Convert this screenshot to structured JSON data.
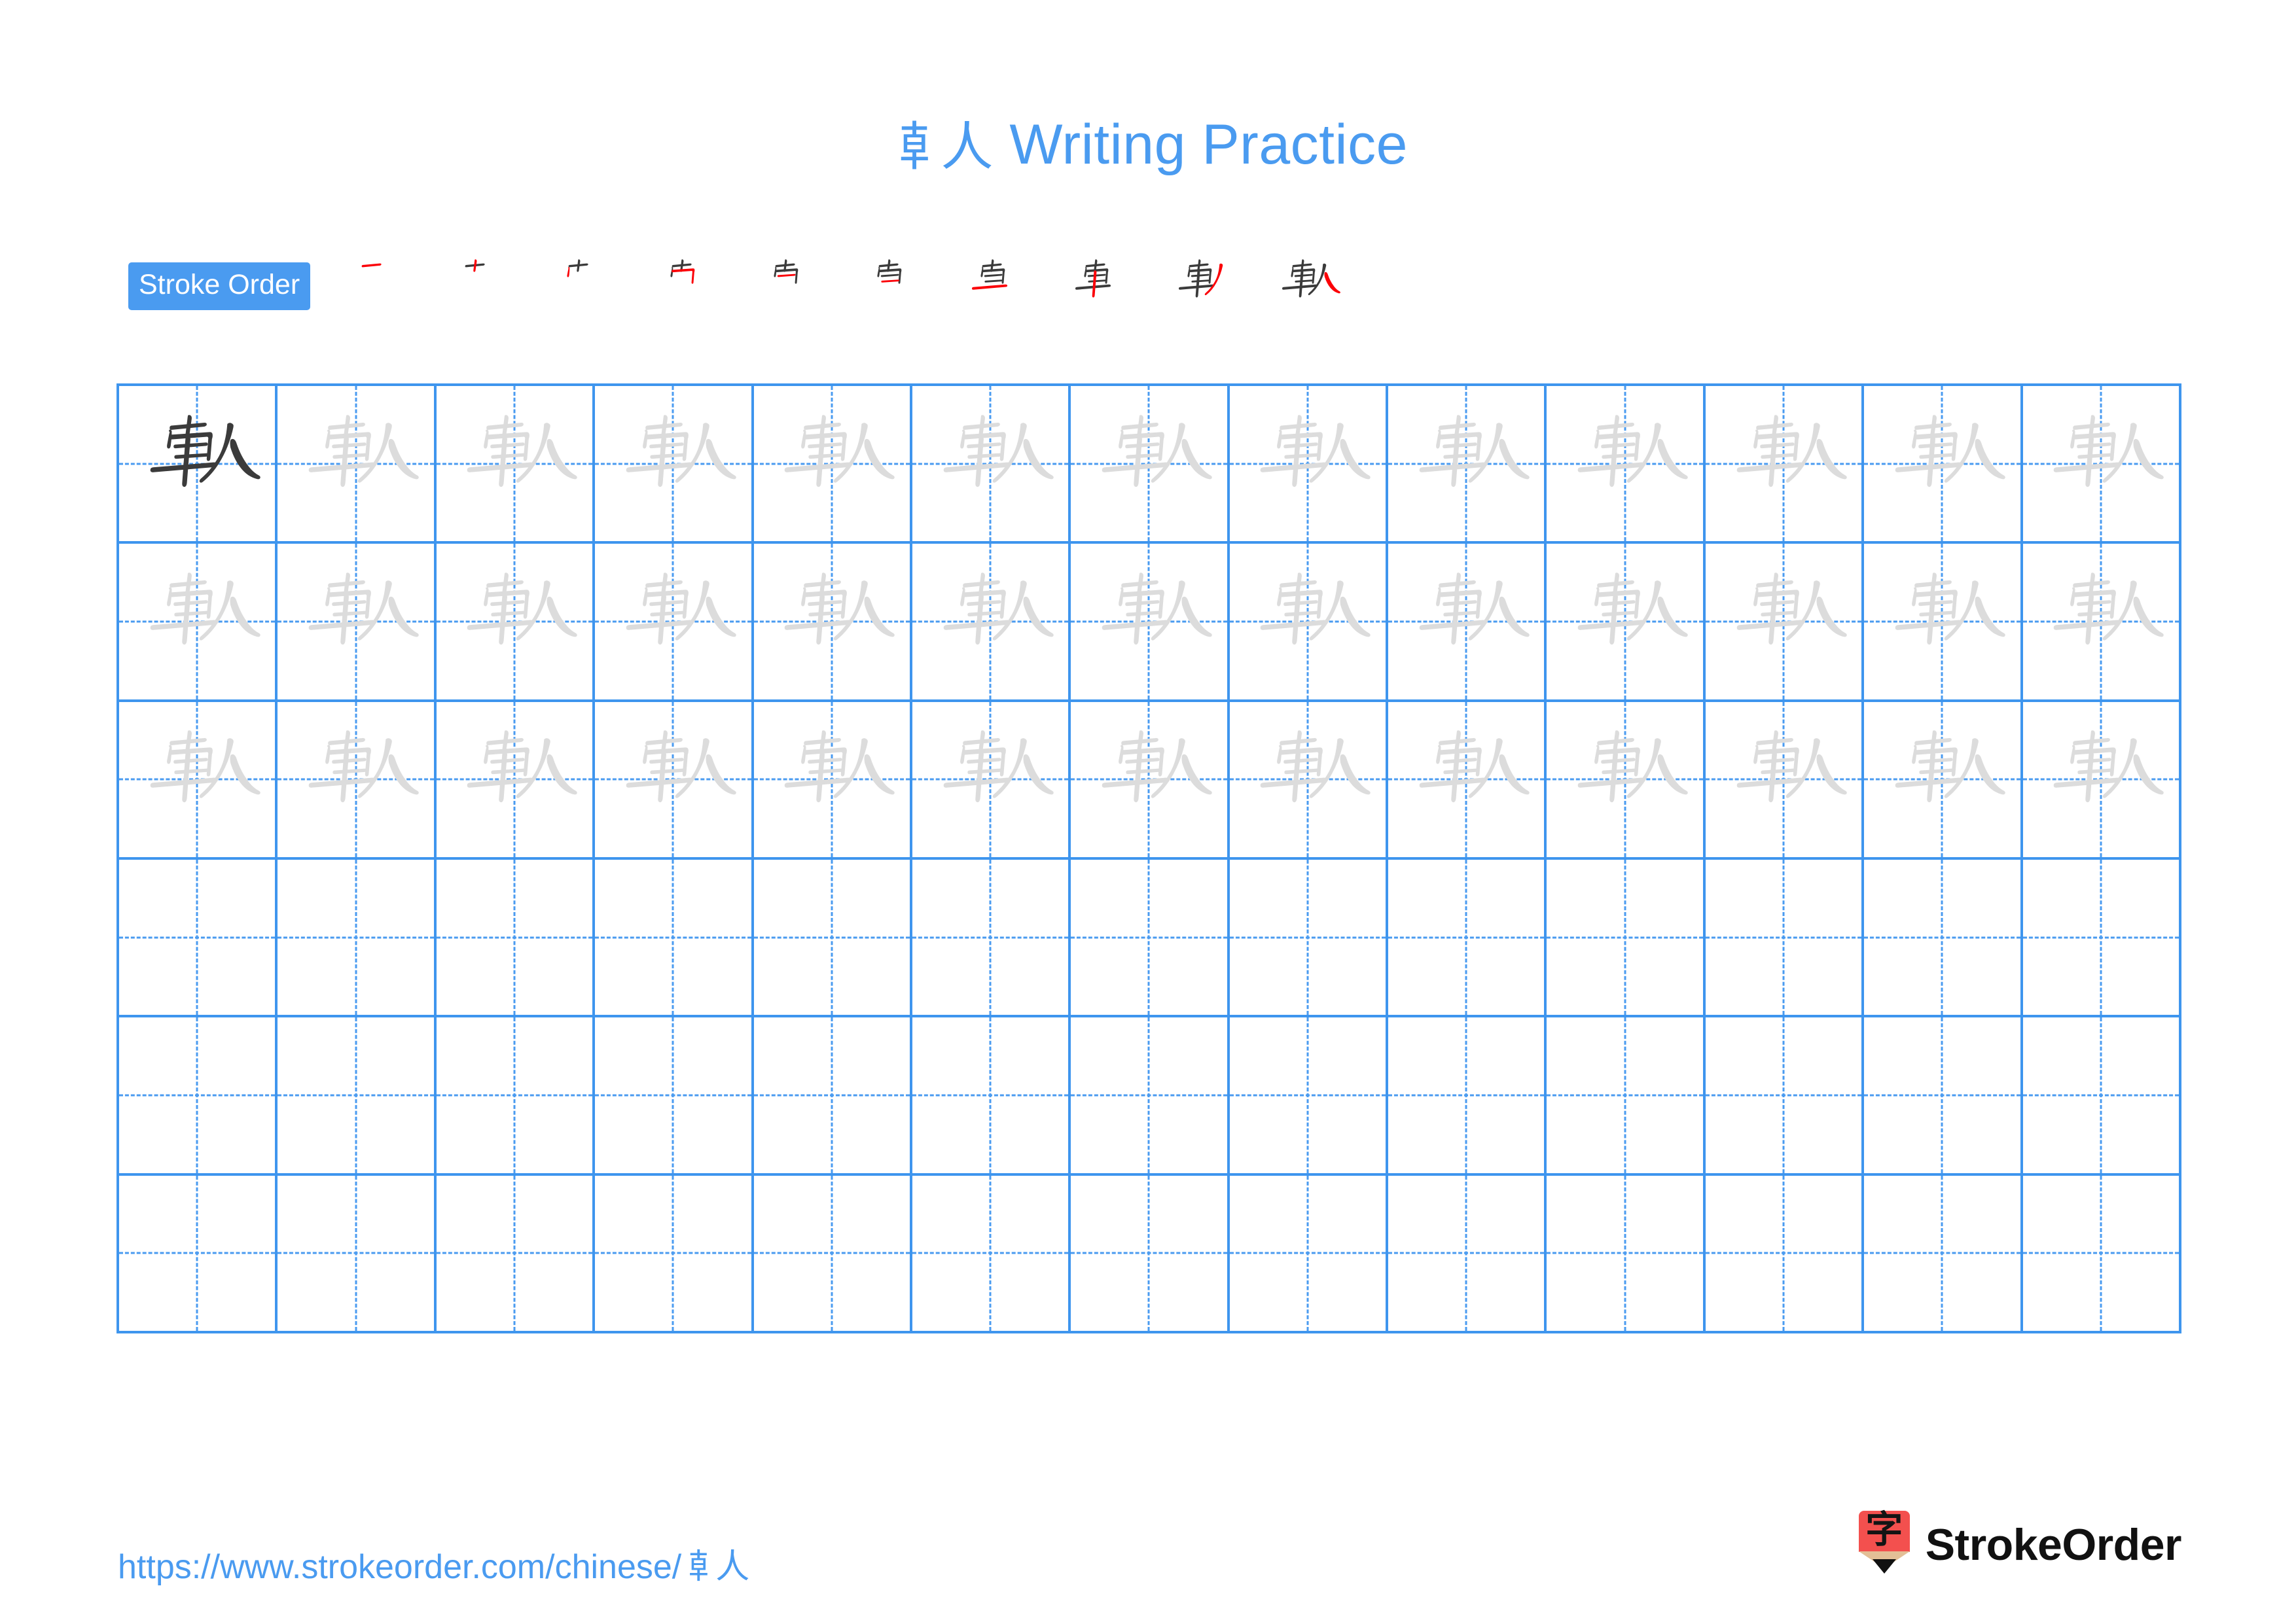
{
  "character": "𠦝人",
  "header": {
    "title_char": "𠦝人",
    "title_suffix": " Writing Practice",
    "title_color": "#4a9bf0"
  },
  "stroke_order": {
    "badge_label": "Stroke Order",
    "badge_bg": "#4a9bf0",
    "badge_text_color": "#ffffff",
    "old_stroke_color": "#3b3b3b",
    "new_stroke_color": "#fb0007",
    "step_count": 10,
    "steps": [
      {
        "index": 1,
        "name": "heng",
        "description": "horizontal"
      },
      {
        "index": 2,
        "name": "shu",
        "description": "vertical"
      },
      {
        "index": 3,
        "name": "shu",
        "description": "vertical left"
      },
      {
        "index": 4,
        "name": "heng-zhe",
        "description": "horizontal turn"
      },
      {
        "index": 5,
        "name": "heng",
        "description": "inner horizontal"
      },
      {
        "index": 6,
        "name": "heng",
        "description": "inner horizontal 2"
      },
      {
        "index": 7,
        "name": "heng",
        "description": "bottom horizontal"
      },
      {
        "index": 8,
        "name": "shu",
        "description": "long vertical"
      },
      {
        "index": 9,
        "name": "pie",
        "description": "left falling"
      },
      {
        "index": 10,
        "name": "na",
        "description": "right falling"
      }
    ]
  },
  "practice_grid": {
    "columns": 13,
    "rows": 6,
    "grid_line_color": "#3e95ee",
    "guide_line_color": "#4a9bf0",
    "dark_glyph_color": "#3b3b3b",
    "light_glyph_color": "#dcdcdc",
    "cells": [
      [
        "dark",
        "light",
        "light",
        "light",
        "light",
        "light",
        "light",
        "light",
        "light",
        "light",
        "light",
        "light",
        "light"
      ],
      [
        "light",
        "light",
        "light",
        "light",
        "light",
        "light",
        "light",
        "light",
        "light",
        "light",
        "light",
        "light",
        "light"
      ],
      [
        "light",
        "light",
        "light",
        "light",
        "light",
        "light",
        "light",
        "light",
        "light",
        "light",
        "light",
        "light",
        "light"
      ],
      [
        "empty",
        "empty",
        "empty",
        "empty",
        "empty",
        "empty",
        "empty",
        "empty",
        "empty",
        "empty",
        "empty",
        "empty",
        "empty"
      ],
      [
        "empty",
        "empty",
        "empty",
        "empty",
        "empty",
        "empty",
        "empty",
        "empty",
        "empty",
        "empty",
        "empty",
        "empty",
        "empty"
      ],
      [
        "empty",
        "empty",
        "empty",
        "empty",
        "empty",
        "empty",
        "empty",
        "empty",
        "empty",
        "empty",
        "empty",
        "empty",
        "empty"
      ]
    ]
  },
  "footer": {
    "url_prefix": "https://www.strokeorder.com/chinese/",
    "url_char": "𠦝人",
    "url_color": "#4a9bf0",
    "brand_name": "StrokeOrder",
    "brand_mark_char": "字",
    "brand_mark_bg": "#f3504e",
    "brand_mark_wood": "#e3bf96",
    "brand_mark_tip": "#111111"
  }
}
